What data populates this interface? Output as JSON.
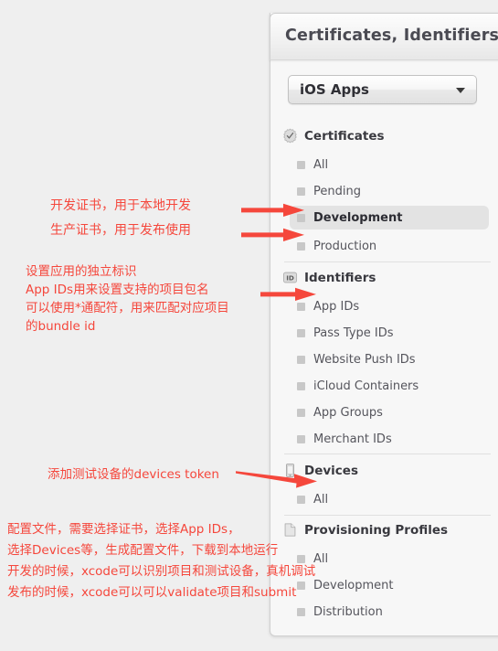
{
  "panel": {
    "title": "Certificates, Identifiers &",
    "selector": {
      "label": "iOS Apps",
      "caret_icon": "chevron-down-icon"
    },
    "groups": [
      {
        "icon": "certificate-seal-icon",
        "title": "Certificates",
        "items": [
          {
            "label": "All",
            "selected": false
          },
          {
            "label": "Pending",
            "selected": false
          },
          {
            "label": "Development",
            "selected": true
          },
          {
            "label": "Production",
            "selected": false
          }
        ]
      },
      {
        "icon": "identifier-id-icon",
        "title": "Identifiers",
        "items": [
          {
            "label": "App IDs",
            "selected": false
          },
          {
            "label": "Pass Type IDs",
            "selected": false
          },
          {
            "label": "Website Push IDs",
            "selected": false
          },
          {
            "label": "iCloud Containers",
            "selected": false
          },
          {
            "label": "App Groups",
            "selected": false
          },
          {
            "label": "Merchant IDs",
            "selected": false
          }
        ]
      },
      {
        "icon": "device-phone-icon",
        "title": "Devices",
        "items": [
          {
            "label": "All",
            "selected": false
          }
        ]
      },
      {
        "icon": "provisioning-document-icon",
        "title": "Provisioning Profiles",
        "items": [
          {
            "label": "All",
            "selected": false
          },
          {
            "label": "Development",
            "selected": false
          },
          {
            "label": "Distribution",
            "selected": false
          }
        ]
      }
    ]
  },
  "annotations": {
    "color": "#f5473c",
    "development_cert": "开发证书，用于本地开发",
    "production_cert": "生产证书，用于发布使用",
    "app_ids_line1": "设置应用的独立标识",
    "app_ids_line2": "App IDs用来设置支持的项目包名",
    "app_ids_line3": "可以使用*通配符，用来匹配对应项目",
    "app_ids_line4": "的bundle id",
    "devices_note": "添加测试设备的devices token",
    "profiles_line1": "配置文件，需要选择证书，选择App IDs，",
    "profiles_line2": "选择Devices等，生成配置文件，下载到本地运行",
    "profiles_line3": "开发的时候，xcode可以识别项目和测试设备，真机调试",
    "profiles_line4": "发布的时候，xcode可以可以validate项目和submit"
  }
}
